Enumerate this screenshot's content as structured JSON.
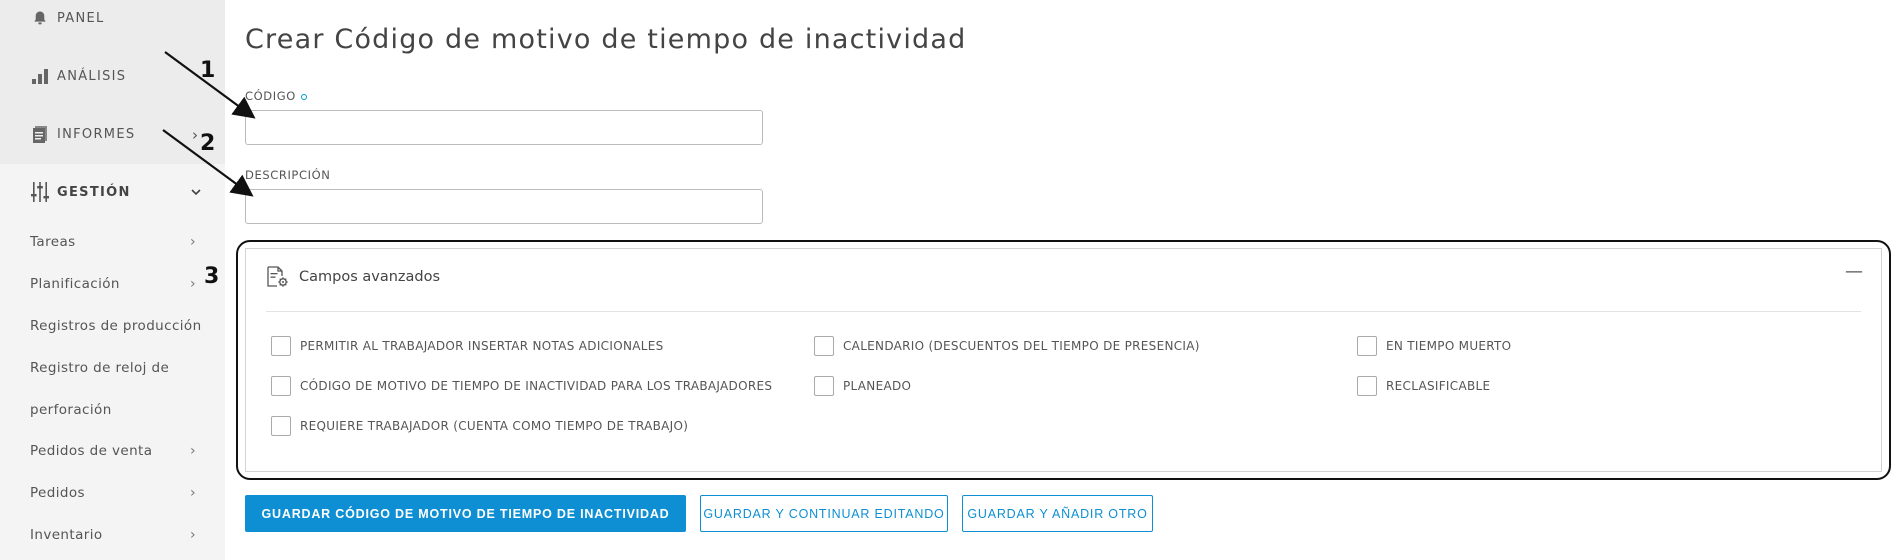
{
  "sidebar": {
    "top_items": [
      {
        "label": "PANEL",
        "icon": "bell-icon"
      },
      {
        "label": "ANÁLISIS",
        "icon": "bar-chart-icon"
      },
      {
        "label": "INFORMES",
        "icon": "report-icon"
      }
    ],
    "section": {
      "label": "GESTIÓN",
      "icon": "sliders-icon"
    },
    "sub_items": [
      {
        "label": "Tareas",
        "has_chevron": true
      },
      {
        "label": "Planificación",
        "has_chevron": true
      },
      {
        "label": "Registros de producción",
        "has_chevron": false
      },
      {
        "label": "Registro de reloj de",
        "has_chevron": false
      },
      {
        "label": "perforación",
        "has_chevron": false
      },
      {
        "label": "Pedidos de venta",
        "has_chevron": true
      },
      {
        "label": "Pedidos",
        "has_chevron": true
      },
      {
        "label": "Inventario",
        "has_chevron": true
      }
    ]
  },
  "page": {
    "title": "Crear Código de motivo de tiempo de inactividad"
  },
  "form": {
    "code": {
      "label": "CÓDIGO",
      "value": "",
      "required": true
    },
    "description": {
      "label": "DESCRIPCIÓN",
      "value": ""
    }
  },
  "advanced": {
    "title": "Campos avanzados",
    "collapse_symbol": "—",
    "checkboxes": [
      {
        "label": "PERMITIR AL TRABAJADOR INSERTAR NOTAS ADICIONALES",
        "checked": false
      },
      {
        "label": "CALENDARIO (DESCUENTOS DEL TIEMPO DE PRESENCIA)",
        "checked": false
      },
      {
        "label": "EN TIEMPO MUERTO",
        "checked": false
      },
      {
        "label": "CÓDIGO DE MOTIVO DE TIEMPO DE INACTIVIDAD PARA LOS TRABAJADORES",
        "checked": false
      },
      {
        "label": "PLANEADO",
        "checked": false
      },
      {
        "label": "RECLASIFICABLE",
        "checked": false
      },
      {
        "label": "REQUIERE TRABAJADOR (CUENTA COMO TIEMPO DE TRABAJO)",
        "checked": false
      }
    ]
  },
  "buttons": {
    "save": "GUARDAR CÓDIGO DE MOTIVO DE TIEMPO DE INACTIVIDAD",
    "save_continue": "GUARDAR Y CONTINUAR EDITANDO",
    "save_add": "GUARDAR Y AÑADIR OTRO"
  },
  "annotations": [
    "1",
    "2",
    "3"
  ],
  "colors": {
    "accent": "#0e8fd3",
    "sidebar_bg": "#f4f4f4",
    "required_dot": "#0096d6"
  }
}
